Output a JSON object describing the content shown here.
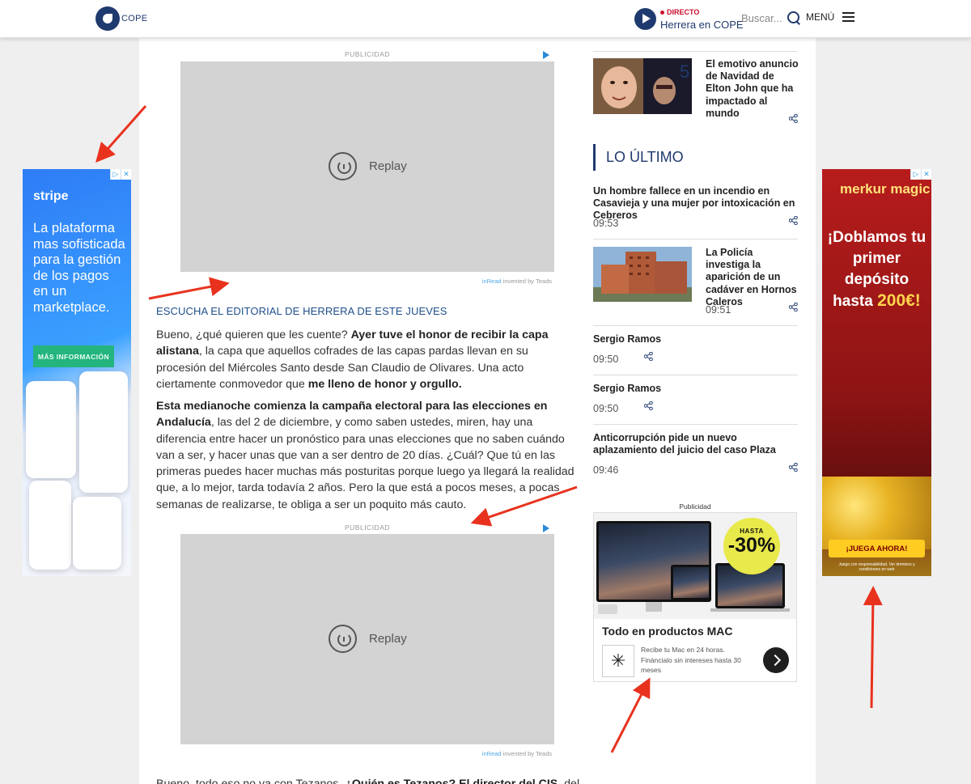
{
  "header": {
    "logo_text": "COPE",
    "live_badge": "DIRECTO",
    "live_program": "Herrera en COPE",
    "search_placeholder": "Buscar...",
    "menu_label": "MENÚ"
  },
  "ads": {
    "stripe": {
      "brand": "stripe",
      "copy": "La plataforma mas sofisticada para la gestión de los pagos en un marketplace.",
      "cta": "MÁS INFORMACIÓN"
    },
    "merkur": {
      "brand": "merkur magic",
      "line1": "¡Doblamos tu primer depósito hasta",
      "amount": "200€!",
      "cta": "¡JUEGA AHORA!",
      "fine_print": "Juego con responsabilidad. Ver términos y condiciones en web"
    },
    "inread_label": "PUBLICIDAD",
    "replay_label": "Replay",
    "inread_brand": "inRead",
    "inread_suffix": "invented by Teads",
    "mac": {
      "label": "Publicidad",
      "badge_top": "HASTA",
      "badge_pct": "-30%",
      "title": "Todo en productos MAC",
      "description": "Recibe tu Mac en 24 horas. Fináncialo sin intereses hasta 30 meses"
    }
  },
  "article": {
    "editorial_link": "ESCUCHA EL EDITORIAL DE HERRERA DE ESTE JUEVES",
    "p1_a": "Bueno, ¿qué quieren que les cuente? ",
    "p1_b": "Ayer tuve el honor de recibir la capa alistana",
    "p1_c": ", la capa que aquellos cofrades de las capas pardas llevan en su procesión del Miércoles Santo desde San Claudio de Olivares. Una acto ciertamente conmovedor que ",
    "p1_d": "me lleno de honor y orgullo.",
    "p2_a": "Esta medianoche comienza la campaña electoral para las elecciones en Andalucía",
    "p2_b": ", las del 2 de diciembre, y como saben ustedes, miren, hay una diferencia entre hacer un pronóstico para unas elecciones que no saben cuándo van a ser, y hacer unas que van a ser dentro de 20 días. ¿Cuál? Que tú en las primeras puedes hacer muchas más posturitas porque luego ya llegará la realidad que, a lo mejor, tarda todavía 2 años. Pero la que está a pocos meses, a pocas semanas de realizarse, te obliga a ser un poquito más cauto.",
    "p3_a": "Bueno, todo eso no va con Tezanos. ",
    "p3_b": "¿Quién es Tezanos? El director del CIS",
    "p3_c": ", del Centro"
  },
  "sidebar": {
    "top_item": {
      "rank": "5",
      "title": "El emotivo anuncio de Navidad de Elton John que ha impactado al mundo"
    },
    "section_title": "LO ÚLTIMO",
    "items": [
      {
        "title": "Un hombre fallece en un incendio en Casavieja y una mujer por intoxicación en Cebreros",
        "time": "09:53"
      },
      {
        "title": "La Policía investiga la aparición de un cadáver en Hornos Caleros",
        "time": "09:51"
      },
      {
        "title": "Sergio Ramos",
        "time": "09:50"
      },
      {
        "title": "Sergio Ramos",
        "time": "09:50"
      },
      {
        "title": "Anticorrupción pide un nuevo aplazamiento del juicio del caso Plaza",
        "time": "09:46"
      }
    ]
  },
  "colors": {
    "brand": "#1f3a6e",
    "annotation": "#e8321e",
    "link": "#1f4f8c"
  }
}
